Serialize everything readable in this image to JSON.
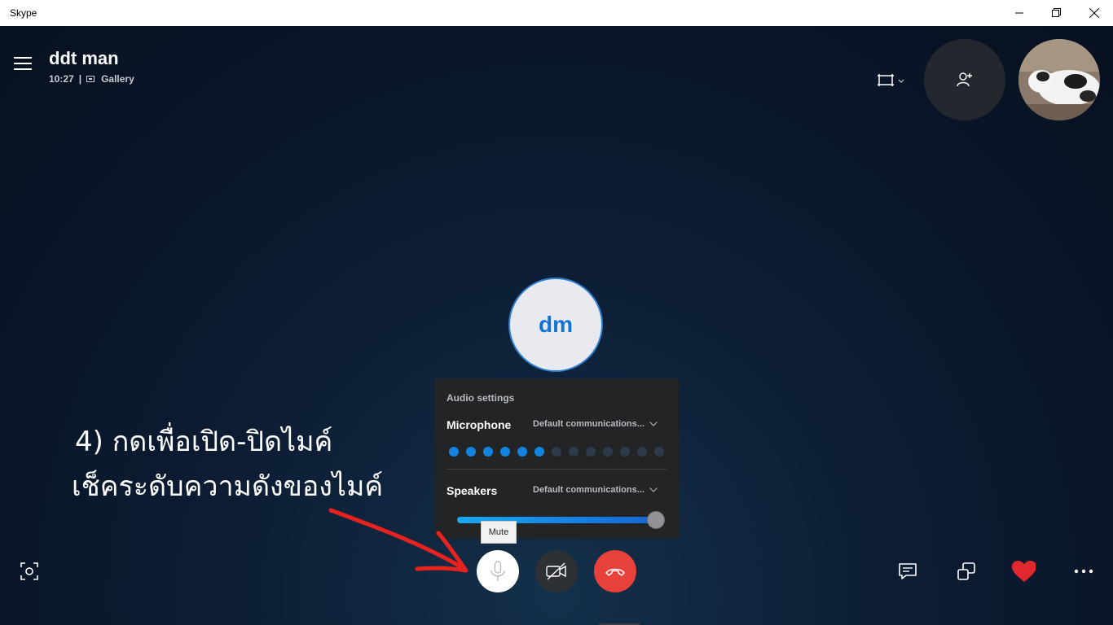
{
  "window": {
    "title": "Skype",
    "controls": [
      "minimize-icon",
      "restore-icon",
      "close-icon"
    ]
  },
  "header": {
    "contact_name": "ddt man",
    "duration": "10:27",
    "separator": "|",
    "view_mode": "Gallery"
  },
  "participant": {
    "initials": "dm",
    "accent_color": "#1273d3"
  },
  "audio_settings": {
    "title": "Audio settings",
    "microphone_label": "Microphone",
    "microphone_device": "Default communications...",
    "mic_level": {
      "active": 6,
      "total": 13
    },
    "speakers_label": "Speakers",
    "speakers_device": "Default communications...",
    "speaker_volume_percent": 100
  },
  "tooltip": {
    "text": "Mute"
  },
  "annotation": {
    "line1": "4) กดเพื่อเปิด-ปิดไมค์",
    "line2": "เช็คระดับความดังของไมค์",
    "arrow_color": "#e8221e"
  },
  "call_controls": {
    "hangup_color": "#e8413c",
    "mic_button_color": "#ffffff",
    "video_button_color": "#2d3034"
  },
  "icons": {
    "menu": "hamburger-icon",
    "view": "gallery-icon",
    "add_people": "add-person-icon",
    "screenshot": "snapshot-icon",
    "chat": "chat-icon",
    "share": "share-screen-icon",
    "react": "heart-icon",
    "more": "more-options-icon"
  },
  "colors": {
    "heart": "#e0282e",
    "mic_dot_active": "#1383e0"
  }
}
